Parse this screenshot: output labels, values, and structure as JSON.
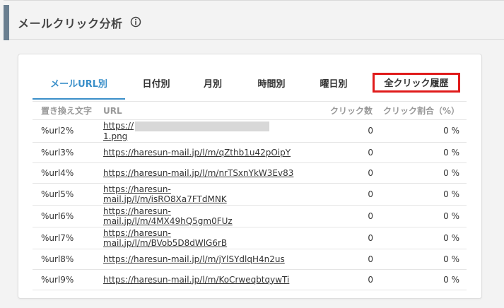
{
  "header": {
    "title": "メールクリック分析"
  },
  "tabs": [
    {
      "label": "メールURL別"
    },
    {
      "label": "日付別"
    },
    {
      "label": "月別"
    },
    {
      "label": "時間別"
    },
    {
      "label": "曜日別"
    },
    {
      "label": "全クリック履歴"
    }
  ],
  "table": {
    "columns": [
      "置き換え文字",
      "URL",
      "クリック数",
      "クリック割合（%）"
    ],
    "rows": [
      {
        "key": "%url2%",
        "url_prefix": "https://",
        "url_suffix": "1.png",
        "clicks": "0",
        "rate": "0 %"
      },
      {
        "key": "%url3%",
        "url": "https://haresun-mail.jp/l/m/qZthb1u42pOipY",
        "clicks": "0",
        "rate": "0 %"
      },
      {
        "key": "%url4%",
        "url": "https://haresun-mail.jp/l/m/nrTSxnYkW3Ev83",
        "clicks": "0",
        "rate": "0 %"
      },
      {
        "key": "%url5%",
        "url": "https://haresun-mail.jp/l/m/isRO8Xa7FTdMNK",
        "clicks": "0",
        "rate": "0 %"
      },
      {
        "key": "%url6%",
        "url": "https://haresun-mail.jp/l/m/4MX49hQ5gm0FUz",
        "clicks": "0",
        "rate": "0 %"
      },
      {
        "key": "%url7%",
        "url": "https://haresun-mail.jp/l/m/BVob5D8dWlG6rB",
        "clicks": "0",
        "rate": "0 %"
      },
      {
        "key": "%url8%",
        "url": "https://haresun-mail.jp/l/m/jYlSYdlqH4n2us",
        "clicks": "0",
        "rate": "0 %"
      },
      {
        "key": "%url9%",
        "url": "https://haresun-mail.jp/l/m/KoCrweqbtqywTi",
        "clicks": "0",
        "rate": "0 %"
      }
    ]
  },
  "colors": {
    "accent": "#3a8fc9",
    "highlight": "#e01b1b",
    "header_bar": "#6a7f90"
  },
  "icons": {
    "info": "info-circle-icon"
  }
}
